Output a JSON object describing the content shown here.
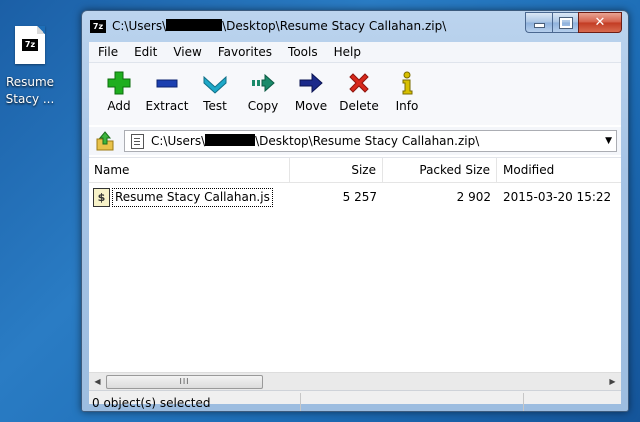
{
  "desktop": {
    "icon_badge": "7z",
    "icon_label_line1": "Resume",
    "icon_label_line2": "Stacy ..."
  },
  "window": {
    "app_icon": "7z",
    "title_prefix": "C:\\Users\\",
    "title_suffix": "\\Desktop\\Resume Stacy Callahan.zip\\",
    "close_glyph": "✕"
  },
  "menu": {
    "items": [
      "File",
      "Edit",
      "View",
      "Favorites",
      "Tools",
      "Help"
    ]
  },
  "toolbar": {
    "buttons": [
      "Add",
      "Extract",
      "Test",
      "Copy",
      "Move",
      "Delete",
      "Info"
    ],
    "colors": {
      "add": "#1fae1f",
      "extract": "#1b3fb0",
      "test": "#1ea8c8",
      "copy": "#1a8a6a",
      "move": "#1b2a8a",
      "delete": "#d8281c",
      "info": "#d8c000"
    }
  },
  "address": {
    "prefix": "C:\\Users\\",
    "suffix": "\\Desktop\\Resume Stacy Callahan.zip\\"
  },
  "list": {
    "columns": [
      "Name",
      "Size",
      "Packed Size",
      "Modified"
    ],
    "rows": [
      {
        "icon": "$",
        "name": "Resume Stacy Callahan.js",
        "size": "5 257",
        "packed": "2 902",
        "modified": "2015-03-20 15:22"
      }
    ]
  },
  "scrollbar": {
    "left_arrow": "◀",
    "right_arrow": "▶",
    "thumb_grip": "III"
  },
  "status": {
    "text": "0 object(s) selected"
  }
}
